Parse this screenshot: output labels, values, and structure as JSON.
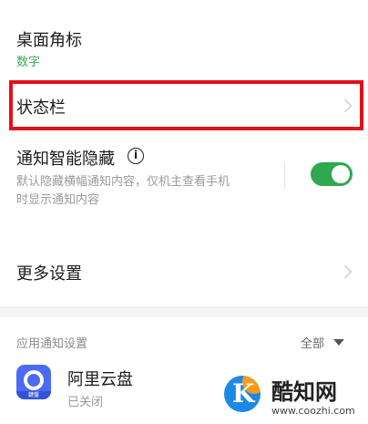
{
  "rows": {
    "badge": {
      "title": "桌面角标",
      "value": "数字"
    },
    "status_bar": {
      "title": "状态栏"
    },
    "smart_hide": {
      "title": "通知智能隐藏",
      "desc_line1": "默认隐藏横幅通知内容，仅机主查看手机",
      "desc_line2": "时显示通知内容",
      "enabled": true
    },
    "more": {
      "title": "更多设置"
    }
  },
  "app_section": {
    "header": "应用通知设置",
    "filter": "全部",
    "apps": [
      {
        "name": "阿里云盘",
        "status": "已关闭",
        "icon": "aliyun-drive-icon"
      }
    ]
  },
  "watermark": {
    "name": "酷知网",
    "url": "www.coozhi.com"
  },
  "colors": {
    "accent_green": "#34a853",
    "highlight_red": "#e30f1a",
    "toggle_on": "#2fa84f",
    "app_blue": "#4b6bf5"
  }
}
